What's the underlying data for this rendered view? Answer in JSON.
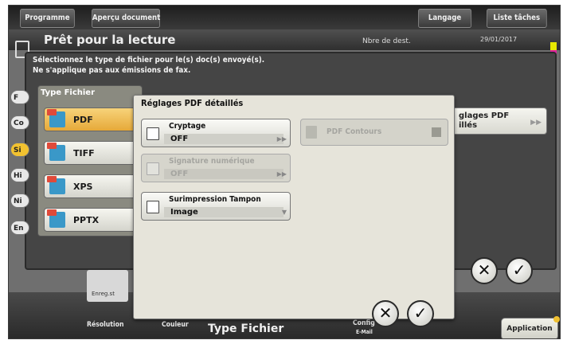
{
  "topbar": {
    "programme": "Programme",
    "apercu": "Aperçu document",
    "langage": "Langage",
    "liste_taches": "Liste tâches"
  },
  "status": {
    "title": "Prêt pour la lecture",
    "nb_dest": "Nbre de dest.",
    "date": "29/01/2017"
  },
  "instruction": {
    "line1": "Sélectionnez le type de fichier pour le(s) doc(s) envoyé(s).",
    "line2": "Ne s'applique pas aux émissions de fax."
  },
  "left_tabs": [
    "F",
    "Co",
    "Si",
    "Hi",
    "Ni",
    "En"
  ],
  "type_fichier": {
    "title": "Type Fichier",
    "options": [
      {
        "label": "PDF",
        "selected": true
      },
      {
        "label": "TIFF",
        "selected": false
      },
      {
        "label": "XPS",
        "selected": false
      },
      {
        "label": "PPTX",
        "selected": false
      }
    ]
  },
  "right_button": {
    "line1": "glages PDF",
    "line2": "illés"
  },
  "dialog": {
    "title": "Réglages PDF détaillés",
    "cryptage": {
      "label": "Cryptage",
      "value": "OFF"
    },
    "signature": {
      "label": "Signature numérique",
      "value": "OFF"
    },
    "surimpression": {
      "label": "Surimpression Tampon",
      "value": "Image"
    },
    "pdf_contours": {
      "label": "PDF Contours"
    }
  },
  "bottombar": {
    "resolution": "Résolution",
    "couleur": "Couleur",
    "type_fichier": "Type Fichier",
    "config": "Config",
    "e_mail": "E-Mail",
    "application": "Application",
    "reso_icon_text": "Enreg.st"
  },
  "colors": {
    "selected_tab": "#f2c230",
    "pdf_selected": "#e6a939",
    "dialog_bg": "#e6e4da"
  }
}
